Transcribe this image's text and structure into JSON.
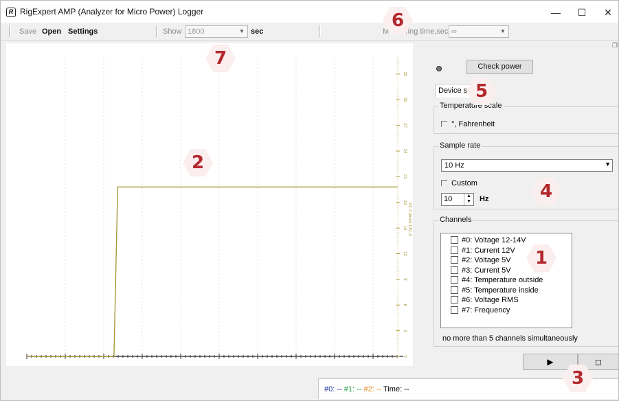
{
  "window": {
    "title": "RigExpert AMP (Analyzer for Micro Power) Logger",
    "icon_glyph": "R",
    "controls": {
      "minimize": "—",
      "maximize": "☐",
      "close": "✕"
    }
  },
  "toolbar": {
    "save_label": "Save",
    "open_label": "Open",
    "settings_label": "Settings",
    "show_label": "Show",
    "show_value": "1800",
    "show_unit": "sec",
    "measuring_label": "Measuring time,sec",
    "measuring_value": "∞"
  },
  "chart_data": {
    "type": "line",
    "xlabel": "",
    "ylabel": "#1: Current 12V, A",
    "y_ticks": [
      "0",
      "3",
      "6",
      "9",
      "12",
      "15",
      "18",
      "21",
      "24",
      "27",
      "30",
      "33"
    ],
    "ylim": [
      0,
      35
    ],
    "grid": true,
    "series": [
      {
        "name": "#1: Current 12V, A",
        "color": "#a89a3a",
        "x": [
          0,
          0.235,
          0.245,
          1.0
        ],
        "values": [
          0,
          0,
          19.8,
          19.8
        ]
      }
    ]
  },
  "panel": {
    "check_power_label": "Check power",
    "tab_label": "Device s",
    "temperature": {
      "title": "Temperature scale",
      "fahrenheit_label": "°, Fahrenheit"
    },
    "sample_rate": {
      "title": "Sample rate",
      "selected": "10 Hz",
      "custom_label": "Custom",
      "custom_value": "10",
      "unit": "Hz"
    },
    "channels": {
      "title": "Channels",
      "items": [
        "#0: Voltage 12-14V",
        "#1: Current 12V",
        "#2: Voltage 5V",
        "#3: Current 5V",
        "#4: Temperature outside",
        "#5: Temperature inside",
        "#6: Voltage RMS",
        "#7: Frequency"
      ],
      "note": "no more than 5 channels simultaneously"
    },
    "play_glyph": "▶",
    "stop_glyph": "◻"
  },
  "status": {
    "ch0_label": "#0:",
    "ch0_value": "--",
    "ch1_label": "#1:",
    "ch1_value": "--",
    "ch2_label": "#2:",
    "ch2_value": "--",
    "time_label": "Time:",
    "time_value": "--",
    "colors": {
      "ch0": "#1f2fa0",
      "ch1": "#1f9a3a",
      "ch2": "#e08a1a"
    }
  },
  "callouts": {
    "c1": "1",
    "c2": "2",
    "c3": "3",
    "c4": "4",
    "c5": "5",
    "c6": "6",
    "c7": "7"
  }
}
